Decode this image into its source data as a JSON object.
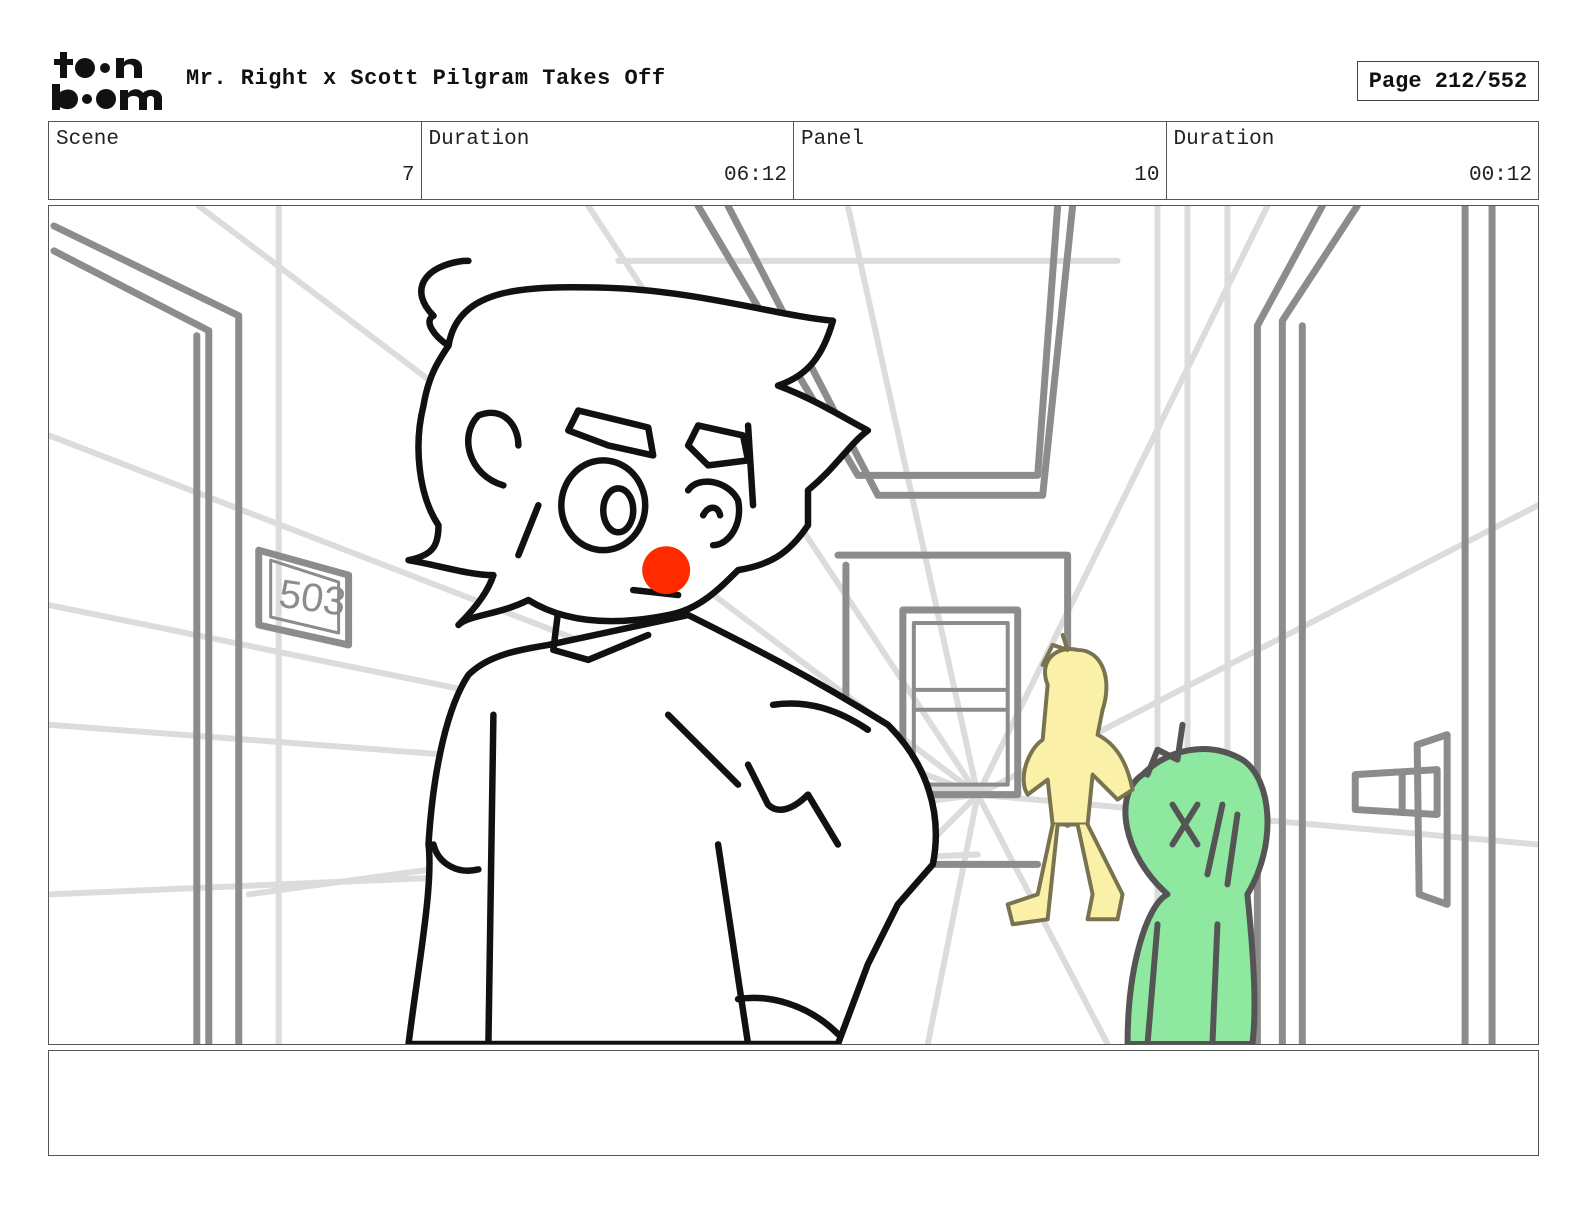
{
  "header": {
    "logo_text": "toonboom",
    "project_title": "Mr. Right x Scott Pilgram Takes Off",
    "page_label": "Page 212/552"
  },
  "info": {
    "scene_label": "Scene",
    "scene_value": "7",
    "scene_duration_label": "Duration",
    "scene_duration_value": "06:12",
    "panel_label": "Panel",
    "panel_value": "10",
    "panel_duration_label": "Duration",
    "panel_duration_value": "00:12"
  },
  "artwork": {
    "room_number": "503",
    "colors": {
      "nose": "#ff2a00",
      "yellow_figure": "#fbf0a8",
      "green_figure": "#8ee8a0",
      "line": "#111111",
      "background_line": "#8c8c8c"
    }
  },
  "notes": {
    "text": ""
  }
}
